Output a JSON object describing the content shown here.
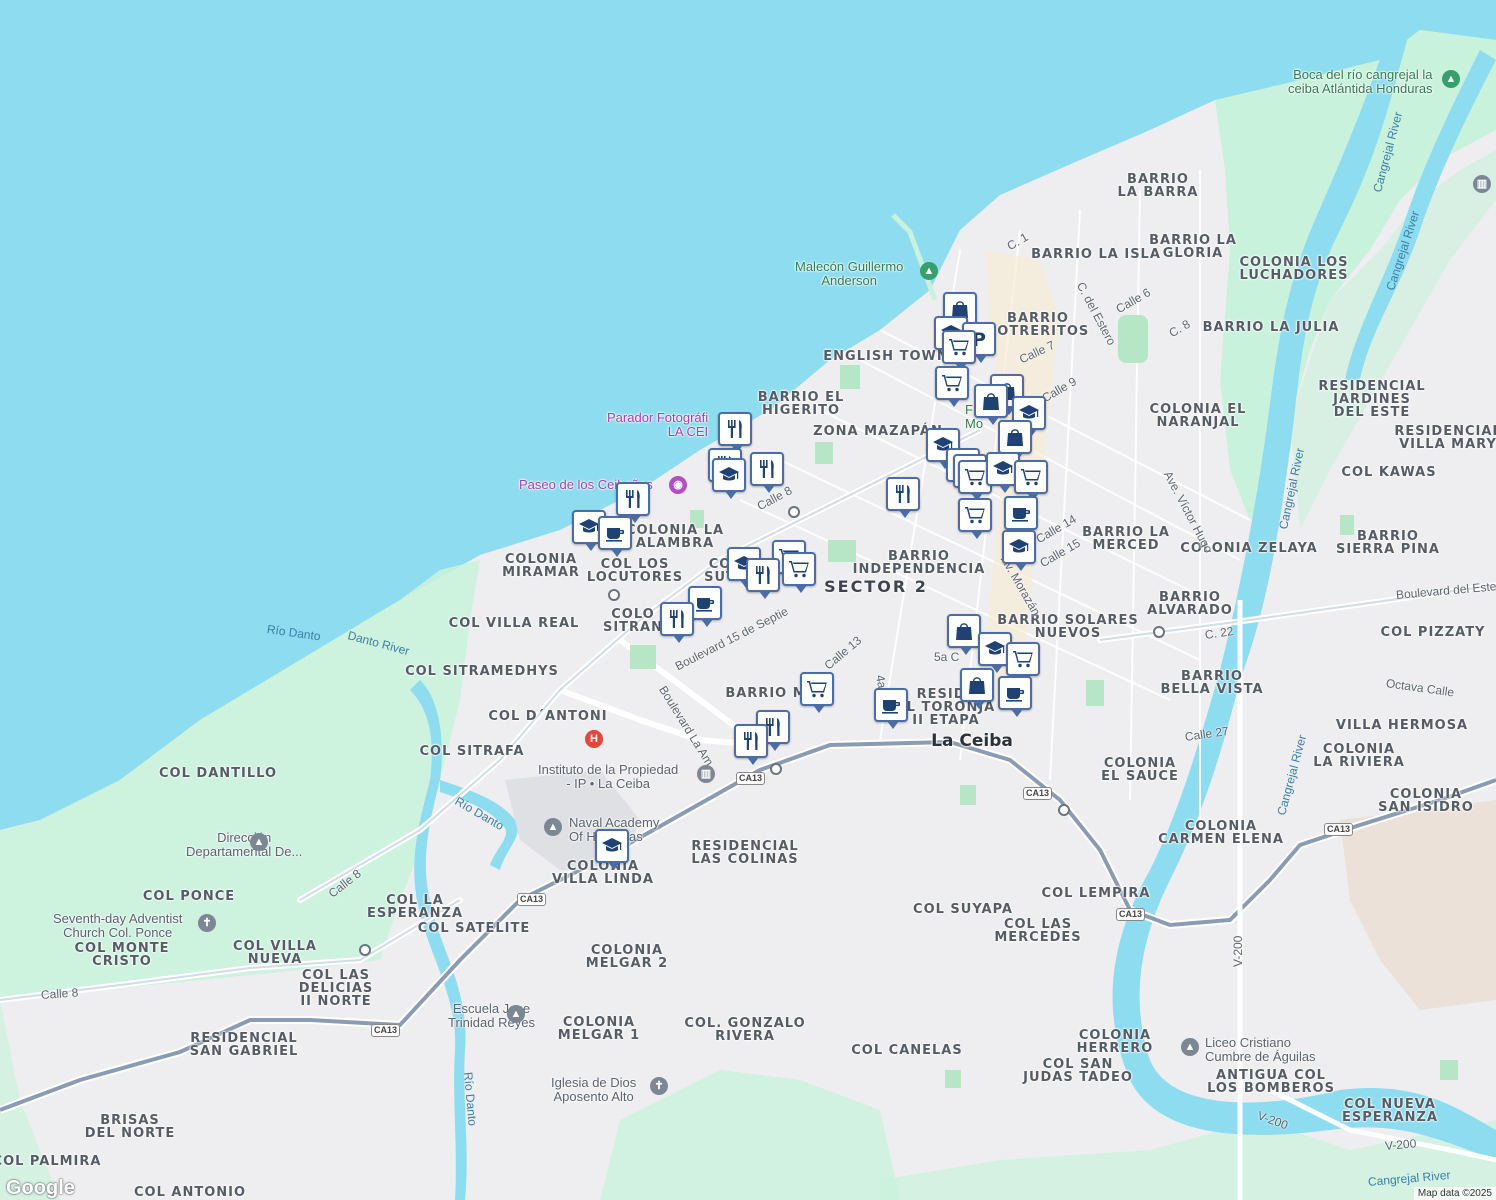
{
  "map": {
    "attribution": "Map data ©2025",
    "logo": "Google",
    "city_label": "La Ceiba",
    "neighborhoods": [
      "BARRIO\nLA BARRA",
      "BARRIO LA ISLA",
      "BARRIO LA\nGLORIA",
      "COLONIA LOS\nLUCHADORES",
      "BARRIO\nPOTRERITOS",
      "BARRIO LA JULIA",
      "ENGLISH TOWN",
      "RESIDENCIAL\nJARDINES\nDEL ESTE",
      "BARRIO EL\nHIGERITO",
      "COLONIA EL\nNARANJAL",
      "RESIDENCIAL\nVILLA MARY",
      "ZONA MAZAPÁN",
      "COL KAWAS",
      "COLONIA LA\nALAMBRA",
      "BARRIO LA\nMERCED",
      "COLONIA ZELAYA",
      "BARRIO\nSIERRA PINA",
      "COLONIA\nMIRAMAR",
      "COL LOS\nLOCUTORES",
      "BARRIO\nINDEPENDENCIA",
      "COL VILLA REAL",
      "BARRIO\nALVARADO",
      "BARRIO SOLARES\nNUEVOS",
      "COL PIZZATY",
      "COL SITRAMEDHYS",
      "BARRIO\nBELLA VISTA",
      "COL D´ANTONI",
      "VILLA HERMOSA",
      "COL SITRAFA",
      "COLONIA\nLA RIVIERA",
      "COL DANTILLO",
      "COLONIA\nEL SAUCE",
      "COLONIA\nSAN ISIDRO",
      "RESIDENCIAL\nLAS COLINAS",
      "COLONIA\nCARMEN ELENA",
      "COL PONCE",
      "COLONIA\nVILLA LINDA",
      "COL LEMPIRA",
      "COL LA\nESPERANZA",
      "COL SUYAPA",
      "COL LAS\nMERCEDES",
      "COL SATELITE",
      "COL VILLA\nNUEVA",
      "COLONIA\nMELGAR 2",
      "COL MONTE\nCRISTO",
      "COL LAS\nDELICIAS\nII NORTE",
      "RESIDENCIAL\nSAN GABRIEL",
      "COLONIA\nMELGAR 1",
      "COL. GONZALO\nRIVERA",
      "COLONIA\nHERRERO",
      "COL CANELAS",
      "COL SAN\nJUDAS TADEO",
      "ANTIGUA COL\nLOS BOMBEROS",
      "BRISAS\nDEL NORTE",
      "COL NUEVA\nESPERANZA",
      "COL PALMIRA",
      "COL ANTONIO",
      "BARRIO M",
      "RESIDE\nEL TORONJA\nII ETAPA",
      "CO\nSUT",
      "COLO\nSITRAN",
      "SECTOR 2"
    ],
    "streets": [
      "C. 1",
      "C. del Estero",
      "Calle 6",
      "C. 8",
      "Calle 7",
      "Calle 9",
      "Calle 8",
      "Ave. Víctor Hugo",
      "Calle 14",
      "Calle 15",
      "Av. Morazán",
      "Boulevard 15 de Septie",
      "Boulevard La Am",
      "Calle 13",
      "4a A",
      "5a C",
      "C. 22",
      "Boulevard del Este",
      "Octava Calle",
      "Calle 27",
      "Calle 8",
      "Calle 8",
      "V-200",
      "V-200",
      "V-200"
    ],
    "rivers": [
      "Cangrejal River",
      "Cangrejal River",
      "Cangrejal River",
      "Cangrejal River",
      "Río Danto",
      "Danto River",
      "Río Danto",
      "Río Danto",
      "Cangrejal River"
    ],
    "highway_shields": [
      "CA13",
      "CA13",
      "CA13",
      "CA13",
      "CA13",
      "CA13"
    ],
    "places": [
      {
        "name": "Boca del río cangrejal la\nceiba Atlántida Honduras",
        "kind": "park",
        "icon": "tree-icon"
      },
      {
        "name": "Malecón Guillermo\nAnderson",
        "kind": "park",
        "icon": "tree-icon"
      },
      {
        "name": "Parador Fotográfi\nLA CEI",
        "kind": "attraction",
        "icon": "camera-icon"
      },
      {
        "name": "Paseo de los Ceibeños",
        "kind": "attraction",
        "icon": "camera-icon"
      },
      {
        "name": "Instituto de la Propiedad\n- IP • La Ceiba",
        "kind": "government",
        "icon": "bank-icon"
      },
      {
        "name": "Naval Academy\nOf Honduras",
        "kind": "school",
        "icon": "school-icon"
      },
      {
        "name": "Dirección\nDepartamental De...",
        "kind": "school",
        "icon": "school-icon"
      },
      {
        "name": "Seventh-day Adventist\nChurch Col. Ponce",
        "kind": "church",
        "icon": "cross-icon"
      },
      {
        "name": "Escuela Jose\nTrinidad Reyes",
        "kind": "school",
        "icon": "school-icon"
      },
      {
        "name": "Iglesia de Dios\nAposento Alto",
        "kind": "church",
        "icon": "cross-icon"
      },
      {
        "name": "Liceo Cristiano\nCumbre de Águilas",
        "kind": "school",
        "icon": "school-icon"
      },
      {
        "name": "F\nMo",
        "kind": "park",
        "icon": "tree-icon"
      }
    ],
    "pin_types": [
      "restaurant-icon",
      "school-icon",
      "cafe-icon",
      "cart-icon",
      "shopping-bag-icon",
      "parking-icon"
    ]
  }
}
